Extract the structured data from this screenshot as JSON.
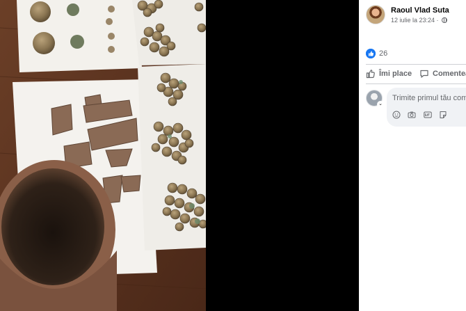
{
  "post": {
    "author": "Raoul Vlad Suta",
    "timestamp": "12 iulie la 23:24 ·",
    "reaction_count": "26",
    "actions": {
      "like_label": "Îmi place",
      "comment_label": "Comentează"
    },
    "comment": {
      "placeholder": "Trimite primul tău comentariu"
    }
  },
  "icons": {
    "privacy": "globe-icon",
    "like_reaction": "thumbs-up-icon",
    "like_action": "thumbs-up-outline-icon",
    "comment_action": "speech-bubble-icon",
    "tools": [
      "emoji-icon",
      "camera-icon",
      "gif-icon",
      "sticker-icon"
    ]
  },
  "colors": {
    "facebook_blue": "#1877f2",
    "secondary_text": "#65676b",
    "comment_box": "#f0f2f5",
    "photo_backdrop": "#000000"
  }
}
